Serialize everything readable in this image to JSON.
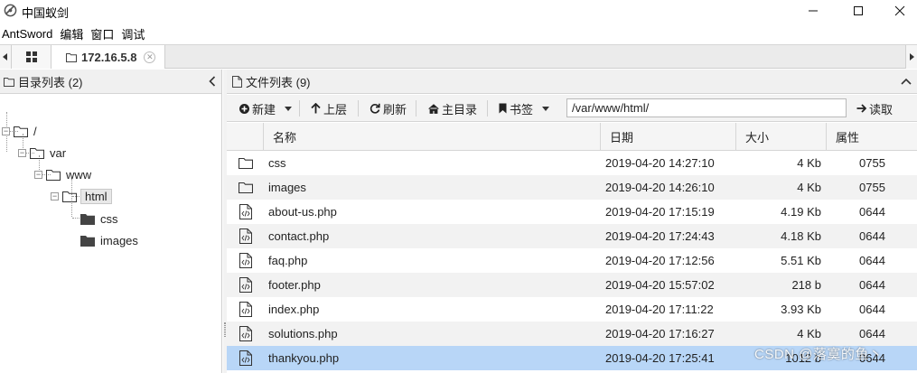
{
  "window": {
    "title": "中国蚁剑",
    "minimize_icon": "minimize-icon",
    "maximize_icon": "maximize-icon",
    "close_icon": "close-icon"
  },
  "menu": {
    "items": [
      "AntSword",
      "编辑",
      "窗口",
      "调试"
    ]
  },
  "tabs": {
    "home_icon": "grid-icon",
    "host_label": "172.16.5.8"
  },
  "dir_panel": {
    "title": "目录列表 (2)",
    "tree": {
      "root": "/",
      "var": "var",
      "www": "www",
      "html": "html",
      "css": "css",
      "images": "images"
    }
  },
  "file_panel": {
    "title": "文件列表 (9)",
    "toolbar": {
      "new_label": "新建",
      "up_label": "上层",
      "refresh_label": "刷新",
      "home_label": "主目录",
      "bookmark_label": "书签",
      "path_value": "/var/www/html/",
      "read_label": "读取"
    },
    "columns": {
      "name": "名称",
      "date": "日期",
      "size": "大小",
      "attr": "属性"
    },
    "rows": [
      {
        "type": "folder",
        "name": "css",
        "date": "2019-04-20 14:27:10",
        "size": "4 Kb",
        "attr": "0755"
      },
      {
        "type": "folder",
        "name": "images",
        "date": "2019-04-20 14:26:10",
        "size": "4 Kb",
        "attr": "0755"
      },
      {
        "type": "php",
        "name": "about-us.php",
        "date": "2019-04-20 17:15:19",
        "size": "4.19 Kb",
        "attr": "0644"
      },
      {
        "type": "php",
        "name": "contact.php",
        "date": "2019-04-20 17:24:43",
        "size": "4.18 Kb",
        "attr": "0644"
      },
      {
        "type": "php",
        "name": "faq.php",
        "date": "2019-04-20 17:12:56",
        "size": "5.51 Kb",
        "attr": "0644"
      },
      {
        "type": "php",
        "name": "footer.php",
        "date": "2019-04-20 15:57:02",
        "size": "218 b",
        "attr": "0644"
      },
      {
        "type": "php",
        "name": "index.php",
        "date": "2019-04-20 17:11:22",
        "size": "3.93 Kb",
        "attr": "0644"
      },
      {
        "type": "php",
        "name": "solutions.php",
        "date": "2019-04-20 17:16:27",
        "size": "4 Kb",
        "attr": "0644"
      },
      {
        "type": "php",
        "name": "thankyou.php",
        "date": "2019-04-20 17:25:41",
        "size": "1012 b",
        "attr": "0644"
      }
    ]
  },
  "watermark": "CSDN @落寞的鱼丶",
  "colors": {
    "selected_row": "#b8d6f7",
    "alt_row": "#f2f2f2"
  }
}
